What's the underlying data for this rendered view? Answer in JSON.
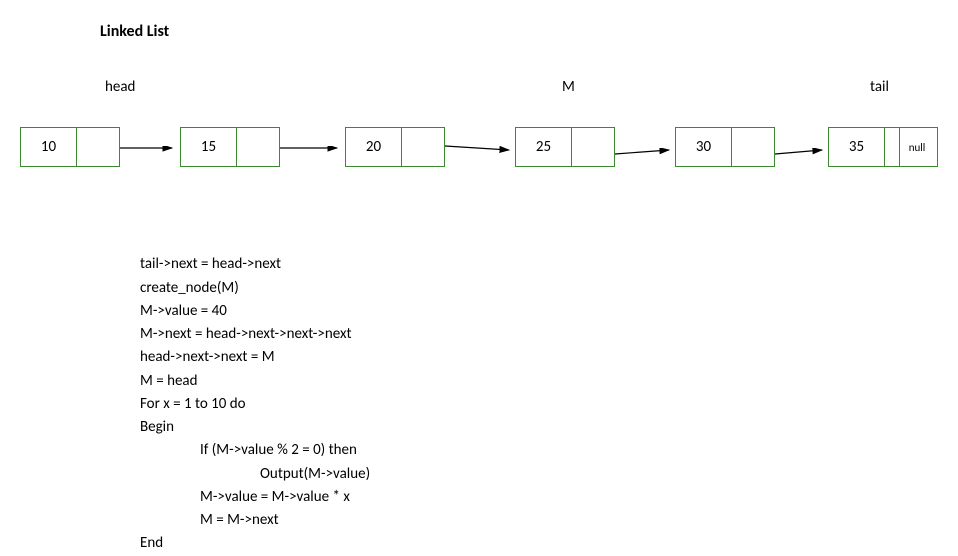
{
  "title": "Linked List",
  "labels": {
    "head": "head",
    "M": "M",
    "tail": "tail"
  },
  "nodes": {
    "n1": "10",
    "n2": "15",
    "n3": "20",
    "n4": "25",
    "n5": "30",
    "n6": "35",
    "null_label": "null"
  },
  "code": {
    "l1": "tail->next = head->next",
    "l2": "create_node(M)",
    "l3": "M->value = 40",
    "l4": "M->next = head->next->next->next",
    "l5": "head->next->next = M",
    "l6": "M = head",
    "l7": "For x = 1 to 10 do",
    "l8": "Begin",
    "l9": "If (M->value % 2 = 0) then",
    "l10": "Output(M->value)",
    "l11": "M->value = M->value * x",
    "l12": "M = M->next",
    "l13": "End"
  }
}
